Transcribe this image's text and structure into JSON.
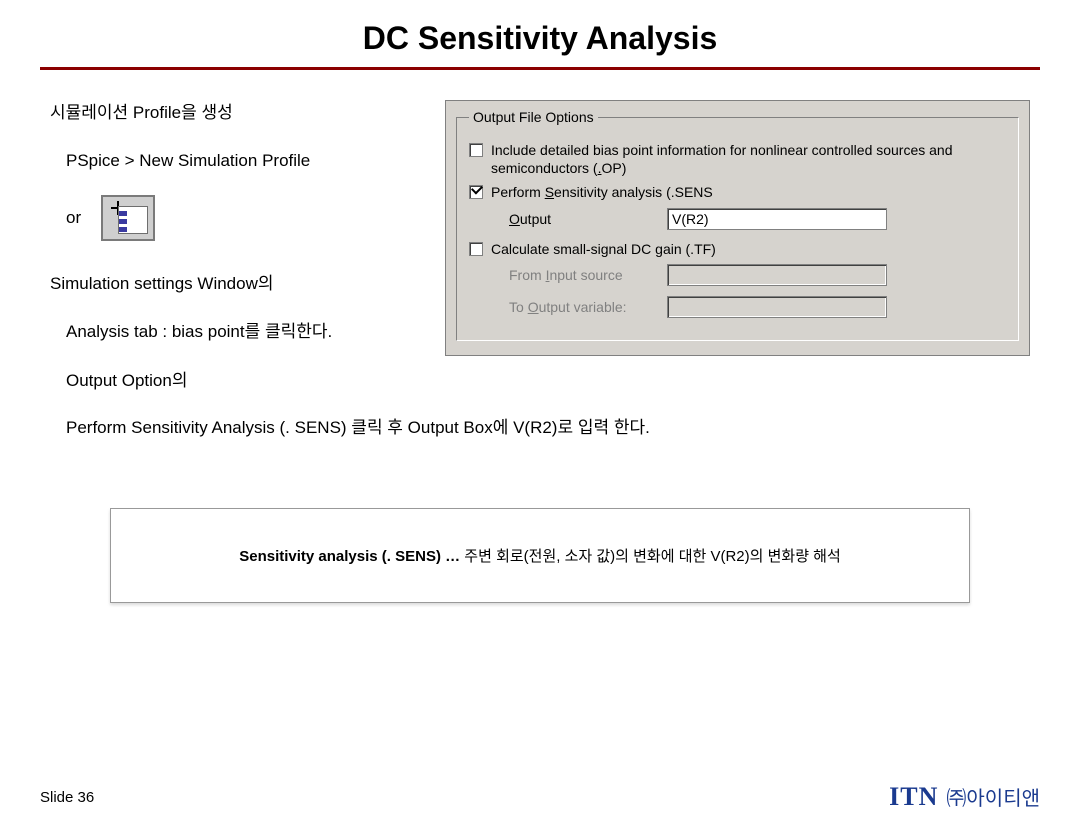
{
  "title": "DC Sensitivity Analysis",
  "instructions": {
    "line1": "시뮬레이션 Profile을 생성",
    "line2": "PSpice > New Simulation Profile",
    "or": "or",
    "line3": "Simulation settings Window의",
    "line4": "Analysis tab : bias point를 클릭한다.",
    "line5": "Output Option의",
    "line6": "Perform Sensitivity Analysis (. SENS) 클릭 후  Output Box에 V(R2)로 입력 한다."
  },
  "dialog": {
    "group_label": "Output File Options",
    "opt1": {
      "checked": false,
      "pre": "Include detailed bias point information for nonlinear controlled sources and semiconductors (",
      "u": ".",
      "post": "OP)"
    },
    "opt2": {
      "checked": true,
      "text_pre": "Perform ",
      "text_u": "S",
      "text_post": "ensitivity analysis (.SENS",
      "output_label_pre": "",
      "output_label_u": "O",
      "output_label_post": "utput",
      "output_value": "V(R2)"
    },
    "opt3": {
      "checked": false,
      "text": "Calculate small-signal DC gain (.TF)",
      "from_pre": "From ",
      "from_u": "I",
      "from_post": "nput source",
      "to_pre": "To ",
      "to_u": "O",
      "to_post": "utput variable:",
      "from_value": "",
      "to_value": ""
    }
  },
  "callout": {
    "lead": "Sensitivity analysis (. SENS) …",
    "rest": " 주변 회로(전원, 소자 값)의 변화에 대한 V(R2)의 변화량 해석"
  },
  "footer": {
    "slide": "Slide 36",
    "brand_en": "ITN",
    "brand_ko": "㈜아이티앤"
  }
}
